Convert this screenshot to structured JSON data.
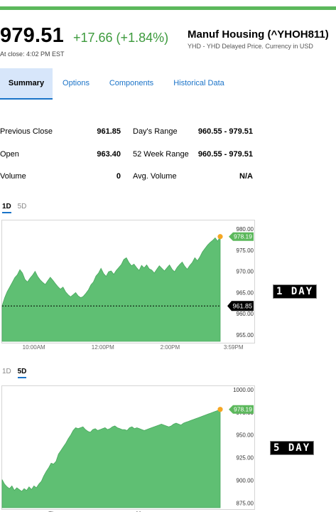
{
  "header": {
    "price": "979.51",
    "change": "+17.66 (+1.84%)",
    "title": "Manuf Housing (^YHOH811)",
    "subtitle": "YHD - YHD Delayed Price. Currency in USD",
    "close_time": "At close: 4:02 PM EST"
  },
  "tabs": [
    {
      "label": "Summary"
    },
    {
      "label": "Options"
    },
    {
      "label": "Components"
    },
    {
      "label": "Historical Data"
    }
  ],
  "stats": {
    "rows": [
      {
        "label1": "Previous Close",
        "value1": "961.85",
        "label2": "Day's Range",
        "value2": "960.55 - 979.51"
      },
      {
        "label1": "Open",
        "value1": "963.40",
        "label2": "52 Week Range",
        "value2": "960.55 - 979.51"
      },
      {
        "label1": "Volume",
        "value1": "0",
        "label2": "Avg. Volume",
        "value2": "N/A"
      }
    ]
  },
  "chart1": {
    "range_tabs": [
      {
        "label": "1D",
        "active": true
      },
      {
        "label": "5D",
        "active": false
      }
    ],
    "current_label": "978.19",
    "prev_close_label": "961.85",
    "overlay": "1 DAY"
  },
  "chart2": {
    "range_tabs": [
      {
        "label": "1D",
        "active": false
      },
      {
        "label": "5D",
        "active": true
      }
    ],
    "current_label": "978.19",
    "overlay": "5 DAY"
  },
  "colors": {
    "accent_green": "#5cb85c",
    "change_green": "#3c9a3c",
    "link_blue": "#1a73c8",
    "tab_active_bg": "#d7e6fa",
    "area_fill": "#5fbf73",
    "marker_orange": "#f5a623"
  },
  "chart_data": [
    {
      "type": "area",
      "ylim": [
        953.5,
        981.5
      ],
      "yticks": [
        "980.00",
        "975.00",
        "970.00",
        "965.00",
        "960.00",
        "955.00"
      ],
      "yticks_num": [
        980,
        975,
        970,
        965,
        960,
        955
      ],
      "xticks": [
        "10:00AM",
        "12:00PM",
        "2:00PM",
        "3:59PM"
      ],
      "xticks_pos": [
        0.128,
        0.4,
        0.665,
        0.915
      ],
      "prev_close": 961.85,
      "last": 978.19,
      "values": [
        961.9,
        963.8,
        965.2,
        966.3,
        967.4,
        968.5,
        969.2,
        970.4,
        969.6,
        968.1,
        967.5,
        968.4,
        969.1,
        970.0,
        968.8,
        968.0,
        967.4,
        966.9,
        967.8,
        968.6,
        967.9,
        967.1,
        966.4,
        965.8,
        966.3,
        965.2,
        964.5,
        964.0,
        964.5,
        965.0,
        964.2,
        963.8,
        964.1,
        964.8,
        965.6,
        966.8,
        967.5,
        968.9,
        969.6,
        970.7,
        969.5,
        968.8,
        969.9,
        970.1,
        969.3,
        970.2,
        970.9,
        971.6,
        972.8,
        973.2,
        972.1,
        971.3,
        971.7,
        970.9,
        970.2,
        971.4,
        970.8,
        971.5,
        970.6,
        970.3,
        969.6,
        970.5,
        971.3,
        970.7,
        970.1,
        970.8,
        971.5,
        970.5,
        969.9,
        970.9,
        971.6,
        972.2,
        971.2,
        970.5,
        971.4,
        972.1,
        973.2,
        972.5,
        973.4,
        974.6,
        975.4,
        976.2,
        976.8,
        977.3,
        977.9,
        977.1,
        978.19
      ]
    },
    {
      "type": "area",
      "ylim": [
        870,
        1003
      ],
      "yticks": [
        "1000.00",
        "975.00",
        "950.00",
        "925.00",
        "900.00",
        "875.00"
      ],
      "yticks_num": [
        1000,
        975,
        950,
        925,
        900,
        875
      ],
      "xticks": [
        "Thu",
        "Mon"
      ],
      "xticks_pos": [
        0.205,
        0.553
      ],
      "last": 978.19,
      "values": [
        901,
        896,
        893,
        891,
        894,
        889,
        892,
        890,
        888,
        891,
        889,
        893,
        890,
        894,
        892,
        896,
        899,
        905,
        910,
        914,
        919,
        918,
        921,
        929,
        933,
        937,
        941,
        946,
        950,
        955,
        958,
        957,
        958,
        959,
        956,
        954,
        953,
        956,
        957,
        955,
        956,
        957,
        958,
        956,
        957,
        959,
        960,
        958,
        957,
        956,
        956,
        955,
        958,
        959,
        957,
        958,
        957,
        956,
        955,
        956,
        957,
        958,
        959,
        960,
        961,
        962,
        961,
        960,
        959,
        960,
        962,
        963,
        962,
        961,
        963,
        964,
        965,
        966,
        967,
        968,
        969,
        970,
        971,
        972,
        973,
        974,
        975,
        976,
        977,
        978.19
      ]
    }
  ]
}
